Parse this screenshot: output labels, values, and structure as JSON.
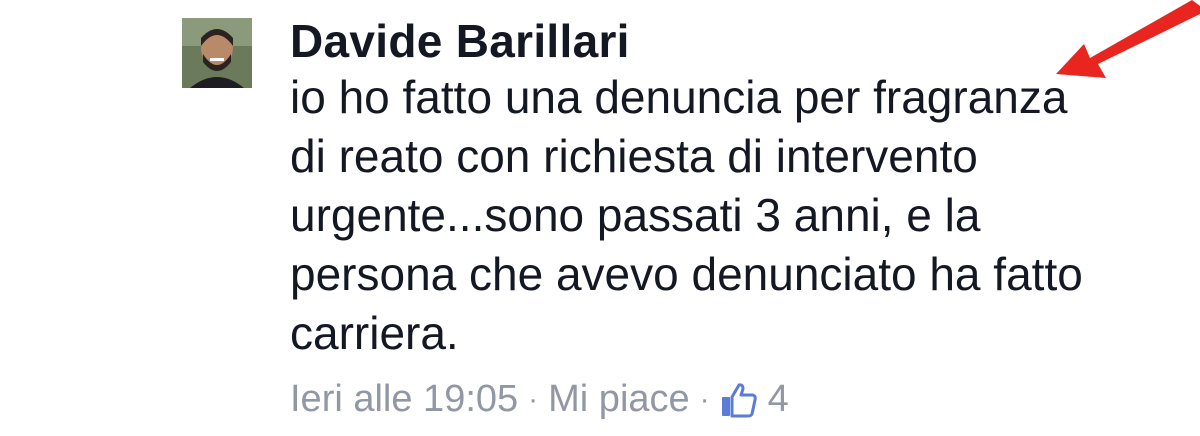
{
  "comment": {
    "author_name": "Davide Barillari",
    "body_lines": [
      "io ho fatto una denuncia per fragranza",
      "di reato con richiesta di intervento",
      "urgente...sono passati 3 anni, e la",
      "persona che avevo denunciato ha fatto",
      "carriera."
    ],
    "timestamp": "Ieri alle 19:05",
    "separator": "·",
    "like_label": "Mi piace",
    "like_count": "4",
    "like_icon": "thumbs-up-icon"
  },
  "colors": {
    "text": "#141823",
    "meta": "#9197a3",
    "like_icon": "#5b7bd5",
    "annotation_arrow": "#e8261f"
  }
}
